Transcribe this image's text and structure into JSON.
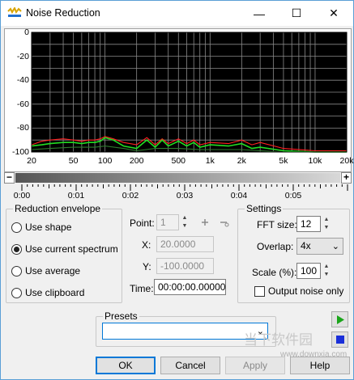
{
  "window": {
    "title": "Noise Reduction",
    "minimize": "—",
    "maximize": "☐",
    "close": "✕"
  },
  "colors": {
    "plot_bg": "#000000",
    "grid": "#8a8a8a",
    "series_noise": "#ff2020",
    "series_green": "#22dd22",
    "series_dark": "#2f7a2f",
    "accent": "#0078d7"
  },
  "chart_data": {
    "type": "line",
    "xscale": "log",
    "xlim": [
      20,
      20000
    ],
    "ylim": [
      -100,
      0
    ],
    "y_ticks": [
      "0",
      "-20",
      "-40",
      "-60",
      "-80",
      "-100"
    ],
    "x_ticks": [
      {
        "label": "20",
        "value": 20
      },
      {
        "label": "50",
        "value": 50
      },
      {
        "label": "100",
        "value": 100
      },
      {
        "label": "200",
        "value": 200
      },
      {
        "label": "500",
        "value": 500
      },
      {
        "label": "1k",
        "value": 1000
      },
      {
        "label": "2k",
        "value": 2000
      },
      {
        "label": "5k",
        "value": 5000
      },
      {
        "label": "10k",
        "value": 10000
      },
      {
        "label": "20k",
        "value": 20000
      }
    ],
    "series": [
      {
        "color": "#ff2020",
        "x": [
          20,
          25,
          30,
          40,
          50,
          60,
          70,
          80,
          90,
          100,
          120,
          150,
          200,
          250,
          300,
          350,
          400,
          500,
          600,
          700,
          800,
          1000,
          1500,
          2000,
          2500,
          3000,
          5000,
          10000,
          20000
        ],
        "y": [
          -94,
          -91,
          -90,
          -89,
          -90,
          -91,
          -90,
          -90,
          -89,
          -87,
          -89,
          -92,
          -94,
          -88,
          -94,
          -89,
          -93,
          -89,
          -93,
          -90,
          -94,
          -92,
          -93,
          -90,
          -94,
          -92,
          -97,
          -99,
          -99
        ]
      },
      {
        "color": "#22dd22",
        "x": [
          20,
          25,
          30,
          40,
          50,
          60,
          70,
          80,
          90,
          100,
          120,
          150,
          200,
          250,
          300,
          350,
          400,
          500,
          600,
          700,
          800,
          1000,
          1500,
          2000,
          2500,
          3000,
          5000,
          10000,
          20000
        ],
        "y": [
          -95,
          -94,
          -93,
          -92,
          -92,
          -93,
          -92,
          -92,
          -91,
          -88,
          -90,
          -95,
          -97,
          -90,
          -96,
          -90,
          -95,
          -91,
          -95,
          -92,
          -96,
          -94,
          -95,
          -93,
          -97,
          -96,
          -99,
          -100,
          -100
        ]
      },
      {
        "color": "#2f7a2f",
        "x": [
          20,
          30,
          50,
          80,
          100,
          150,
          200,
          300,
          500,
          800,
          1000,
          2000,
          3000,
          5000,
          10000,
          20000
        ],
        "y": [
          -98,
          -97,
          -96,
          -96,
          -95,
          -97,
          -99,
          -97,
          -97,
          -98,
          -98,
          -98,
          -99,
          -100,
          -100,
          -100
        ]
      }
    ]
  },
  "slider": {
    "minus": "−",
    "plus": "+"
  },
  "timeline": {
    "labels": [
      "0:00",
      "0:01",
      "0:02",
      "0:03",
      "0:04",
      "0:05"
    ]
  },
  "reduction_envelope": {
    "legend": "Reduction envelope",
    "options": [
      "Use shape",
      "Use current spectrum",
      "Use average",
      "Use clipboard"
    ],
    "selected": 1
  },
  "point": {
    "point_label": "Point:",
    "point_value": "1",
    "x_label": "X:",
    "x_value": "20.0000",
    "y_label": "Y:",
    "y_value": "-100.0000",
    "time_label": "Time:",
    "time_value": "00:00:00.00000"
  },
  "settings": {
    "legend": "Settings",
    "fft_label": "FFT size:",
    "fft_value": "12",
    "overlap_label": "Overlap:",
    "overlap_value": "4x",
    "scale_label": "Scale (%):",
    "scale_value": "100",
    "output_noise_label": "Output noise only"
  },
  "presets": {
    "legend": "Presets",
    "value": ""
  },
  "buttons": {
    "ok": "OK",
    "cancel": "Cancel",
    "apply": "Apply",
    "help": "Help"
  },
  "watermark": {
    "site": "www.downxia.com",
    "brand": "当下软件园"
  }
}
